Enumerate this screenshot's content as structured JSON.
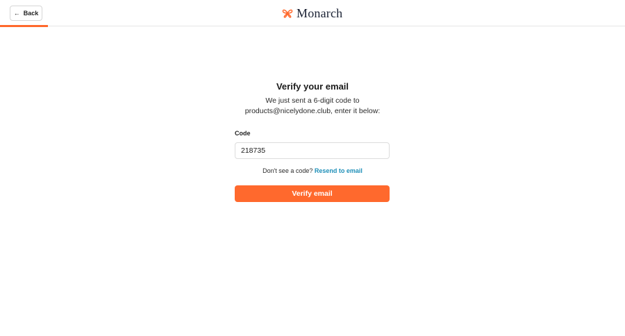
{
  "header": {
    "back_label": "Back",
    "brand_name": "Monarch",
    "progress_fraction": 0.077
  },
  "verify": {
    "title": "Verify your email",
    "description_line1": "We just sent a 6-digit code to",
    "description_line2": "products@nicelydone.club, enter it below:",
    "code_label": "Code",
    "code_value": "218735",
    "resend_prompt": "Don't see a code?",
    "resend_link": "Resend to email",
    "submit_label": "Verify email"
  },
  "colors": {
    "accent": "#ff692d",
    "link": "#1e8fb8",
    "brand_text": "#1b2234"
  }
}
